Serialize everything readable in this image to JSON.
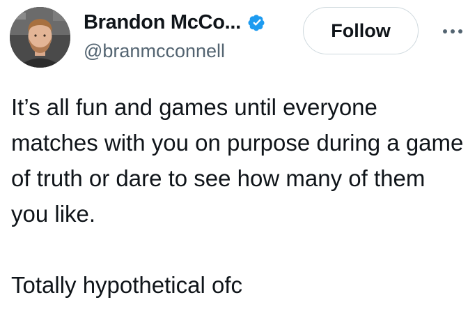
{
  "author": {
    "display_name": "Brandon McCo...",
    "handle": "@branmcconnell",
    "verified_icon": "verified-badge-icon",
    "avatar_icon": "profile-photo"
  },
  "actions": {
    "follow_label": "Follow",
    "more_icon": "more-options-icon"
  },
  "tweet": {
    "line1": "It’s all fun and games until everyone matches with you on purpose during a game of truth or dare to see how many of them you like.",
    "line2": "Totally hypothetical ofc"
  },
  "colors": {
    "text": "#0f1419",
    "secondary": "#536471",
    "verified": "#1d9bf0",
    "button_border": "#cfd9de"
  }
}
